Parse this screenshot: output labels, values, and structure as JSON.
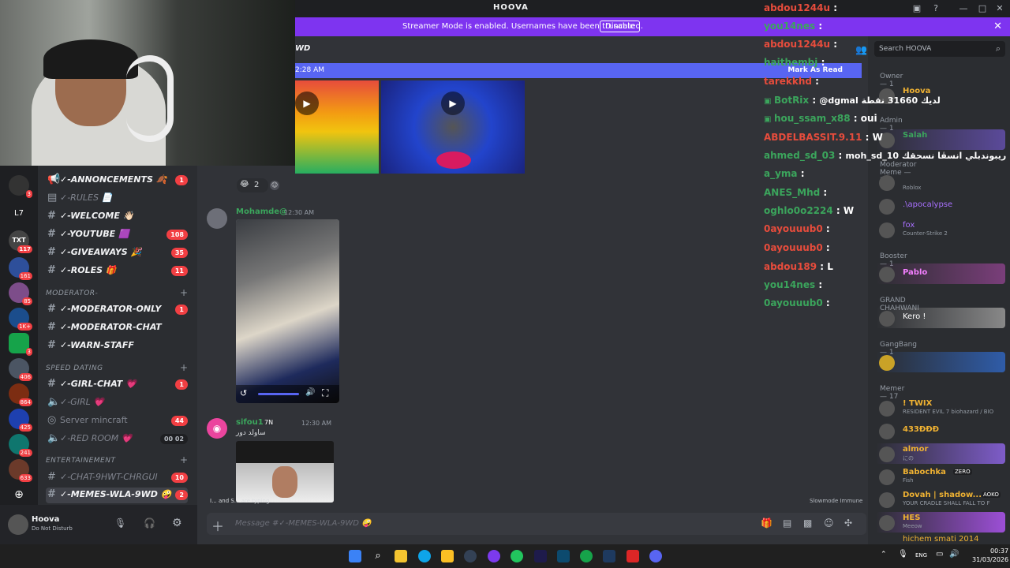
{
  "window": {
    "title": "HOOVA"
  },
  "banner": {
    "text": "Streamer Mode is enabled. Usernames have been truncated.",
    "button": "Disable"
  },
  "channel_header_fragment": "WD",
  "new_messages": {
    "time": "2:28 AM",
    "mark_read": "Mark As Read"
  },
  "reactions": {
    "count": "2"
  },
  "guilds": [
    {
      "label": "",
      "badge": "3"
    },
    {
      "label": "L7",
      "badge": ""
    },
    {
      "label": "TXT",
      "badge": "117"
    },
    {
      "label": "",
      "badge": "161"
    },
    {
      "label": "",
      "badge": "85"
    },
    {
      "label": "",
      "badge": "1K+"
    },
    {
      "label": "",
      "badge": "3"
    },
    {
      "label": "",
      "badge": "406"
    },
    {
      "label": "",
      "badge": "864"
    },
    {
      "label": "",
      "badge": "425"
    },
    {
      "label": "",
      "badge": "241"
    },
    {
      "label": "",
      "badge": "633"
    }
  ],
  "channels": {
    "top": [
      {
        "name": "✓-ANNONCEMENTS 🍂",
        "badge": "1"
      },
      {
        "name": "✓-RULES 📄",
        "badge": ""
      },
      {
        "name": "✓-WELCOME 👋🏻",
        "badge": ""
      },
      {
        "name": "✓-YOUTUBE 🟪",
        "badge": "108"
      },
      {
        "name": "✓-GIVEAWAYS 🎉",
        "badge": "35"
      },
      {
        "name": "✓-ROLES 🎁",
        "badge": "11"
      }
    ],
    "moderator_label": "MODERATOR-",
    "moderator": [
      {
        "name": "✓-MODERATOR-ONLY",
        "badge": "1"
      },
      {
        "name": "✓-MODERATOR-CHAT",
        "badge": ""
      },
      {
        "name": "✓-WARN-STAFF",
        "badge": ""
      }
    ],
    "speed_label": "SPEED DATING",
    "speed": [
      {
        "name": "✓-GIRL-CHAT 💗",
        "badge": "1"
      },
      {
        "name": "✓-GIRL 💗",
        "badge": ""
      },
      {
        "name": "Server mincraft",
        "badge": "44"
      },
      {
        "name": "✓-RED ROOM 💗",
        "badge": "00 02"
      }
    ],
    "ent_label": "ENTERTAINEMENT",
    "ent": [
      {
        "name": "✓-CHAT-9HWT-CHRGUI",
        "badge": "10"
      },
      {
        "name": "✓-MEMES-WLA-9WD 🤪",
        "badge": "2"
      }
    ]
  },
  "user": {
    "name": "Hoova",
    "status": "Do Not Disturb"
  },
  "messages": [
    {
      "author": "Mohamde@",
      "time": "12:30 AM"
    },
    {
      "author": "sifou16",
      "tag": "7N",
      "time": "12:30 AM",
      "text": "ساولد دور"
    }
  ],
  "typing": "I... and S... are typing...",
  "slowmode": "Slowmode Immune",
  "composer": {
    "placeholder": "Message #✓-MEMES-WLA-9WD 🤪"
  },
  "members": {
    "search": "Search HOOVA",
    "groups": [
      {
        "title": "Owner — 1",
        "items": [
          {
            "name": "Hoova",
            "sub": "",
            "color": "#f0b232"
          }
        ]
      },
      {
        "title": "Admin — 1",
        "items": [
          {
            "name": "Salah",
            "sub": "",
            "color": "#3ba55c"
          }
        ]
      },
      {
        "title": "Moderator Meme — 3",
        "items": [
          {
            "name": "",
            "sub": "Roblox",
            "color": "#dbdee1"
          },
          {
            "name": ".\\apocalypse",
            "sub": "",
            "color": "#a970ff"
          },
          {
            "name": "fox",
            "sub": "Counter-Strike 2",
            "color": "#a970ff"
          }
        ]
      },
      {
        "title": "Booster — 1",
        "items": [
          {
            "name": "Pablo",
            "sub": "",
            "color": "#f47fff"
          }
        ]
      },
      {
        "title": "GRAND CHAHWANI — 1",
        "items": [
          {
            "name": "Kero !",
            "sub": "",
            "color": "#ffffff"
          }
        ]
      },
      {
        "title": "GangBang — 1",
        "items": [
          {
            "name": "",
            "sub": "",
            "color": "#f23f43"
          }
        ]
      },
      {
        "title": "Memer — 17",
        "items": [
          {
            "name": "! TWIX",
            "sub": "RESIDENT EVIL 7 biohazard / BIO",
            "color": "#f0b232"
          },
          {
            "name": "433ƉƉƉ",
            "sub": "",
            "color": "#f0b232"
          },
          {
            "name": "almor",
            "sub": "にの",
            "color": "#f0b232"
          },
          {
            "name": "Babochka",
            "sub": "Fish",
            "color": "#f0b232",
            "tag": "ZERO"
          },
          {
            "name": "Dovah | shadow...",
            "sub": "YOUR CRADLE SHALL FALL TO F",
            "color": "#f0b232",
            "tag": "AOKO"
          },
          {
            "name": "HES",
            "sub": "Meeow",
            "color": "#f0b232"
          },
          {
            "name": "hichem smati 2014",
            "sub": "",
            "color": "#f0b232"
          }
        ]
      }
    ]
  },
  "stream_chat": [
    {
      "user": "abdou1244u",
      "msg": "",
      "color": "#e74c3c"
    },
    {
      "user": "you14nes",
      "msg": "",
      "color": "#3ba55c"
    },
    {
      "user": "abdou1244u",
      "msg": "",
      "color": "#e74c3c"
    },
    {
      "user": "haithembj",
      "msg": "",
      "color": "#3ba55c"
    },
    {
      "user": "tarekkhd",
      "msg": "",
      "color": "#e74c3c"
    },
    {
      "user": "BotRix",
      "msg": "@dgmal لديك 31660 نقطة",
      "color": "#3ba55c"
    },
    {
      "user": "hou_ssam_x88",
      "msg": "oui",
      "color": "#3ba55c"
    },
    {
      "user": "ABDELBASSIT.9.11",
      "msg": "W",
      "color": "#e74c3c"
    },
    {
      "user": "ahmed_sd_03",
      "msg": "moh_sd_10 ريبوندبلي انسڨا نسحقك",
      "color": "#3ba55c"
    },
    {
      "user": "a_yma",
      "msg": "",
      "color": "#3ba55c"
    },
    {
      "user": "ANES_Mhd",
      "msg": "",
      "color": "#3ba55c"
    },
    {
      "user": "oghlo0o2224",
      "msg": "W",
      "color": "#3ba55c"
    },
    {
      "user": "0ayouuub0",
      "msg": "",
      "color": "#e74c3c"
    },
    {
      "user": "0ayouuub0",
      "msg": "",
      "color": "#e74c3c"
    },
    {
      "user": "abdou189",
      "msg": "L",
      "color": "#e74c3c"
    },
    {
      "user": "you14nes",
      "msg": "",
      "color": "#3ba55c"
    },
    {
      "user": "0ayouuub0",
      "msg": "",
      "color": "#3ba55c"
    }
  ],
  "taskbar": {
    "lang": "ENG",
    "time": "00:37",
    "date": "31/03/2026"
  }
}
